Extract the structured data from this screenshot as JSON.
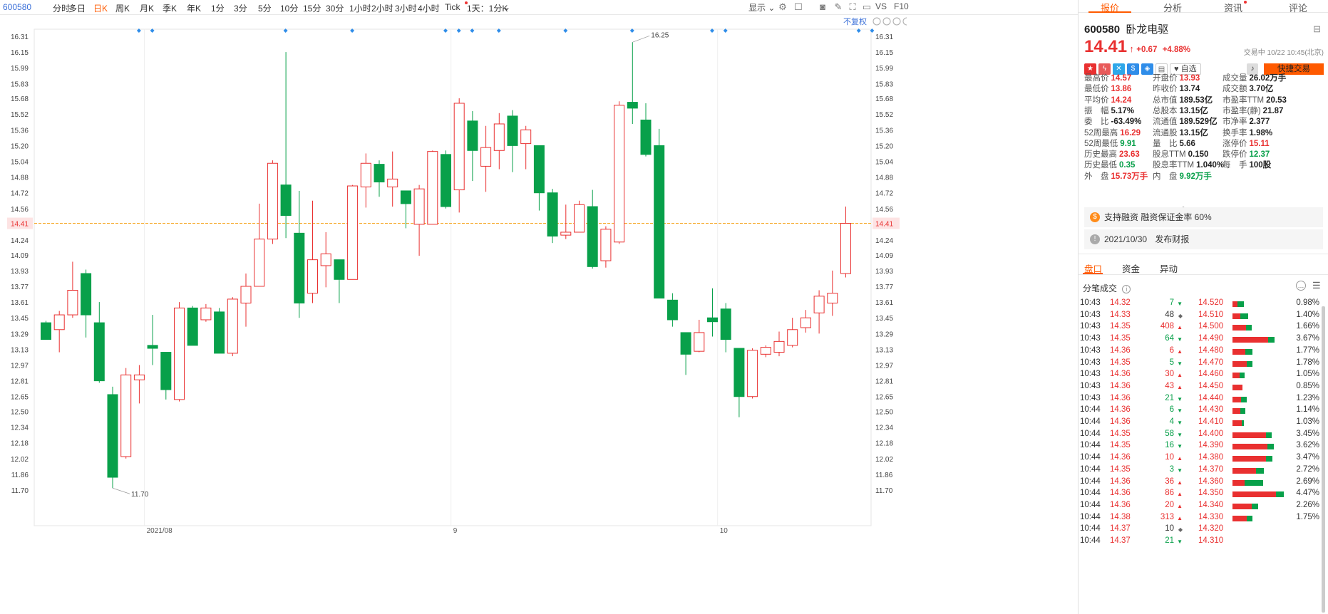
{
  "toolbar": {
    "code": "600580",
    "periods": [
      "分时",
      "多日",
      "日K",
      "周K",
      "月K",
      "季K",
      "年K",
      "1分",
      "3分",
      "5分",
      "10分",
      "15分",
      "30分",
      "1小时",
      "2小时",
      "3小时",
      "4小时",
      "Tick",
      "1天：1分K"
    ],
    "active": "日K",
    "display_label": "显示",
    "vs_label": "VS",
    "f10_label": "F10"
  },
  "chart_data": {
    "type": "candlestick",
    "adjust_label": "不复权",
    "y_ticks": [
      "16.31",
      "16.15",
      "15.99",
      "15.83",
      "15.68",
      "15.52",
      "15.36",
      "15.20",
      "15.04",
      "14.88",
      "14.72",
      "14.56",
      "14.41",
      "14.24",
      "14.09",
      "13.93",
      "13.77",
      "13.61",
      "13.45",
      "13.29",
      "13.13",
      "12.97",
      "12.81",
      "12.65",
      "12.50",
      "12.34",
      "12.18",
      "12.02",
      "11.86",
      "11.70"
    ],
    "ylim": [
      11.7,
      16.31
    ],
    "current_price": "14.41",
    "x_labels": [
      {
        "label": "2021/08",
        "index": 8
      },
      {
        "label": "9",
        "index": 31
      },
      {
        "label": "10",
        "index": 51
      }
    ],
    "high_marker": "16.25",
    "low_marker": "11.70",
    "event_markers_index": [
      7,
      8,
      18,
      23,
      30,
      31,
      32,
      34,
      39,
      44,
      50,
      51,
      61,
      62
    ],
    "candles": [
      [
        13.4,
        13.23,
        13.42,
        13.23
      ],
      [
        13.33,
        13.48,
        13.52,
        13.1
      ],
      [
        13.48,
        13.73,
        14.02,
        13.45
      ],
      [
        13.9,
        13.48,
        13.94,
        13.25
      ],
      [
        13.4,
        12.81,
        13.61,
        12.79
      ],
      [
        12.67,
        11.83,
        12.75,
        11.72
      ],
      [
        12.04,
        12.87,
        12.94,
        12.02
      ],
      [
        12.82,
        12.87,
        12.97,
        12.58
      ],
      [
        13.17,
        13.14,
        13.48,
        12.97
      ],
      [
        13.1,
        12.72,
        13.1,
        12.62
      ],
      [
        12.62,
        13.55,
        13.61,
        12.6
      ],
      [
        13.55,
        13.17,
        13.57,
        13.17
      ],
      [
        13.43,
        13.55,
        13.59,
        13.41
      ],
      [
        13.51,
        13.09,
        13.55,
        13.09
      ],
      [
        13.09,
        13.64,
        13.66,
        13.06
      ],
      [
        13.6,
        13.77,
        13.9,
        13.36
      ],
      [
        13.77,
        14.25,
        14.61,
        13.77
      ],
      [
        14.25,
        15.02,
        15.05,
        14.2
      ],
      [
        14.8,
        14.49,
        16.15,
        14.26
      ],
      [
        14.31,
        13.6,
        14.74,
        13.45
      ],
      [
        13.7,
        14.04,
        14.64,
        13.6
      ],
      [
        13.98,
        14.1,
        14.32,
        13.76
      ],
      [
        14.04,
        13.84,
        14.04,
        13.6
      ],
      [
        13.84,
        14.79,
        14.8,
        13.84
      ],
      [
        14.78,
        15.02,
        15.12,
        14.57
      ],
      [
        15.01,
        14.83,
        15.05,
        14.68
      ],
      [
        14.78,
        14.86,
        15.14,
        14.58
      ],
      [
        14.74,
        14.61,
        14.74,
        14.36
      ],
      [
        14.4,
        14.76,
        14.8,
        14.08
      ],
      [
        14.4,
        15.14,
        15.15,
        14.4
      ],
      [
        15.11,
        14.58,
        15.15,
        14.56
      ],
      [
        14.75,
        15.63,
        15.68,
        14.52
      ],
      [
        15.45,
        15.15,
        15.55,
        14.84
      ],
      [
        14.99,
        15.18,
        15.4,
        14.73
      ],
      [
        15.15,
        15.42,
        15.53,
        14.96
      ],
      [
        15.5,
        15.2,
        15.56,
        14.93
      ],
      [
        15.22,
        15.36,
        15.4,
        14.96
      ],
      [
        15.2,
        14.72,
        15.2,
        14.54
      ],
      [
        14.72,
        14.28,
        14.76,
        14.21
      ],
      [
        14.29,
        14.32,
        14.6,
        14.25
      ],
      [
        14.32,
        14.6,
        14.64,
        14.32
      ],
      [
        14.58,
        13.97,
        14.75,
        13.95
      ],
      [
        14.03,
        14.35,
        14.38,
        13.96
      ],
      [
        14.22,
        15.61,
        15.65,
        14.2
      ],
      [
        15.64,
        15.58,
        16.25,
        15.42
      ],
      [
        15.46,
        15.11,
        15.63,
        15.09
      ],
      [
        15.2,
        13.65,
        15.37,
        13.65
      ],
      [
        13.63,
        13.43,
        13.7,
        13.36
      ],
      [
        13.3,
        13.08,
        13.3,
        12.87
      ],
      [
        13.11,
        13.3,
        13.43,
        13.1
      ],
      [
        13.45,
        13.41,
        13.75,
        13.26
      ],
      [
        13.54,
        13.23,
        13.6,
        13.1
      ],
      [
        13.14,
        12.65,
        13.14,
        12.44
      ],
      [
        12.65,
        13.12,
        13.14,
        12.63
      ],
      [
        13.08,
        13.15,
        13.17,
        13.05
      ],
      [
        13.1,
        13.21,
        13.31,
        13.06
      ],
      [
        13.17,
        13.33,
        13.45,
        13.15
      ],
      [
        13.35,
        13.45,
        13.53,
        13.3
      ],
      [
        13.5,
        13.67,
        13.73,
        13.29
      ],
      [
        13.6,
        13.7,
        13.93,
        13.47
      ],
      [
        13.9,
        14.41,
        14.58,
        13.86
      ]
    ]
  },
  "side": {
    "tabs": [
      "报价",
      "分析",
      "资讯",
      "评论"
    ],
    "code": "600580",
    "name": "卧龙电驱",
    "price": "14.41",
    "change": "+0.67",
    "change_pct": "+4.88%",
    "status": "交易中 10/22 10:45(北京)",
    "watch_label": "自选",
    "quick_trade_label": "快捷交易",
    "quotes": [
      [
        {
          "k": "最高价",
          "v": "14.57",
          "c": "red"
        },
        {
          "k": "开盘价",
          "v": "13.93",
          "c": "red"
        },
        {
          "k": "成交量",
          "v": "26.02万手",
          "c": "blk"
        }
      ],
      [
        {
          "k": "最低价",
          "v": "13.86",
          "c": "red"
        },
        {
          "k": "昨收价",
          "v": "13.74",
          "c": "blk"
        },
        {
          "k": "成交额",
          "v": "3.70亿",
          "c": "blk"
        }
      ],
      [
        {
          "k": "平均价",
          "v": "14.24",
          "c": "red"
        },
        {
          "k": "总市值",
          "v": "189.53亿",
          "c": "blk"
        },
        {
          "k": "市盈率TTM",
          "v": "20.53",
          "c": "blk"
        }
      ],
      [
        {
          "k": "振　幅",
          "v": "5.17%",
          "c": "blk"
        },
        {
          "k": "总股本",
          "v": "13.15亿",
          "c": "blk"
        },
        {
          "k": "市盈率(静)",
          "v": "21.87",
          "c": "blk"
        }
      ],
      [
        {
          "k": "委　比",
          "v": "-63.49%",
          "c": "blk"
        },
        {
          "k": "流通值",
          "v": "189.529亿",
          "c": "blk"
        },
        {
          "k": "市净率",
          "v": "2.377",
          "c": "blk"
        }
      ],
      [
        {
          "k": "52周最高",
          "v": "16.29",
          "c": "red"
        },
        {
          "k": "流通股",
          "v": "13.15亿",
          "c": "blk"
        },
        {
          "k": "换手率",
          "v": "1.98%",
          "c": "blk"
        }
      ],
      [
        {
          "k": "52周最低",
          "v": "9.91",
          "c": "grn"
        },
        {
          "k": "量　比",
          "v": "5.66",
          "c": "blk"
        },
        {
          "k": "涨停价",
          "v": "15.11",
          "c": "red"
        }
      ],
      [
        {
          "k": "历史最高",
          "v": "23.63",
          "c": "red"
        },
        {
          "k": "股息TTM",
          "v": "0.150",
          "c": "blk"
        },
        {
          "k": "跌停价",
          "v": "12.37",
          "c": "grn"
        }
      ],
      [
        {
          "k": "历史最低",
          "v": "0.35",
          "c": "grn"
        },
        {
          "k": "股息率TTM",
          "v": "1.040%",
          "c": "blk"
        },
        {
          "k": "每　手",
          "v": "100股",
          "c": "blk"
        }
      ],
      [
        {
          "k": "外　盘",
          "v": "15.73万手",
          "c": "red"
        },
        {
          "k": "内　盘",
          "v": "9.92万手",
          "c": "grn"
        }
      ]
    ],
    "margin_info": "支持融资 融资保证金率 60%",
    "report_date": "2021/10/30",
    "report_label": "发布财报",
    "subtabs": [
      "盘口",
      "资金",
      "异动"
    ],
    "ticks_title": "分笔成交",
    "trades": [
      {
        "t": "10:43",
        "p": "14.32",
        "v": "7",
        "d": "down"
      },
      {
        "t": "10:43",
        "p": "14.33",
        "v": "48",
        "d": "flat"
      },
      {
        "t": "10:43",
        "p": "14.35",
        "v": "408",
        "d": "up"
      },
      {
        "t": "10:43",
        "p": "14.35",
        "v": "64",
        "d": "down"
      },
      {
        "t": "10:43",
        "p": "14.36",
        "v": "6",
        "d": "up"
      },
      {
        "t": "10:43",
        "p": "14.35",
        "v": "5",
        "d": "down"
      },
      {
        "t": "10:43",
        "p": "14.36",
        "v": "30",
        "d": "up"
      },
      {
        "t": "10:43",
        "p": "14.36",
        "v": "43",
        "d": "up"
      },
      {
        "t": "10:43",
        "p": "14.36",
        "v": "21",
        "d": "down"
      },
      {
        "t": "10:44",
        "p": "14.36",
        "v": "6",
        "d": "down"
      },
      {
        "t": "10:44",
        "p": "14.36",
        "v": "4",
        "d": "down"
      },
      {
        "t": "10:44",
        "p": "14.35",
        "v": "58",
        "d": "down"
      },
      {
        "t": "10:44",
        "p": "14.35",
        "v": "16",
        "d": "down"
      },
      {
        "t": "10:44",
        "p": "14.36",
        "v": "10",
        "d": "up"
      },
      {
        "t": "10:44",
        "p": "14.35",
        "v": "3",
        "d": "down"
      },
      {
        "t": "10:44",
        "p": "14.36",
        "v": "36",
        "d": "up"
      },
      {
        "t": "10:44",
        "p": "14.36",
        "v": "86",
        "d": "up"
      },
      {
        "t": "10:44",
        "p": "14.36",
        "v": "20",
        "d": "up"
      },
      {
        "t": "10:44",
        "p": "14.38",
        "v": "313",
        "d": "up"
      },
      {
        "t": "10:44",
        "p": "14.37",
        "v": "10",
        "d": "flat"
      },
      {
        "t": "10:44",
        "p": "14.37",
        "v": "21",
        "d": "down"
      }
    ],
    "levels": [
      {
        "p": "14.520",
        "pct": "0.98%",
        "r": 0.45
      },
      {
        "p": "14.510",
        "pct": "1.40%",
        "r": 0.5
      },
      {
        "p": "14.500",
        "pct": "1.66%",
        "r": 0.7
      },
      {
        "p": "14.490",
        "pct": "3.67%",
        "r": 0.85
      },
      {
        "p": "14.480",
        "pct": "1.77%",
        "r": 0.65
      },
      {
        "p": "14.470",
        "pct": "1.78%",
        "r": 0.7
      },
      {
        "p": "14.460",
        "pct": "1.05%",
        "r": 0.6
      },
      {
        "p": "14.450",
        "pct": "0.85%",
        "r": 1.0
      },
      {
        "p": "14.440",
        "pct": "1.23%",
        "r": 0.6
      },
      {
        "p": "14.430",
        "pct": "1.14%",
        "r": 0.6
      },
      {
        "p": "14.410",
        "pct": "1.03%",
        "r": 0.8
      },
      {
        "p": "14.400",
        "pct": "3.45%",
        "r": 0.85
      },
      {
        "p": "14.390",
        "pct": "3.62%",
        "r": 0.85
      },
      {
        "p": "14.380",
        "pct": "3.47%",
        "r": 0.85
      },
      {
        "p": "14.370",
        "pct": "2.72%",
        "r": 0.75
      },
      {
        "p": "14.360",
        "pct": "2.69%",
        "r": 0.4
      },
      {
        "p": "14.350",
        "pct": "4.47%",
        "r": 0.85
      },
      {
        "p": "14.340",
        "pct": "2.26%",
        "r": 0.75
      },
      {
        "p": "14.330",
        "pct": "1.75%",
        "r": 0.7
      },
      {
        "p": "14.320",
        "pct": "",
        "r": 0
      },
      {
        "p": "14.310",
        "pct": "",
        "r": 0
      }
    ],
    "colors": {
      "up": "#e93030",
      "down": "#08a04a",
      "accent": "#ff5a00"
    }
  }
}
